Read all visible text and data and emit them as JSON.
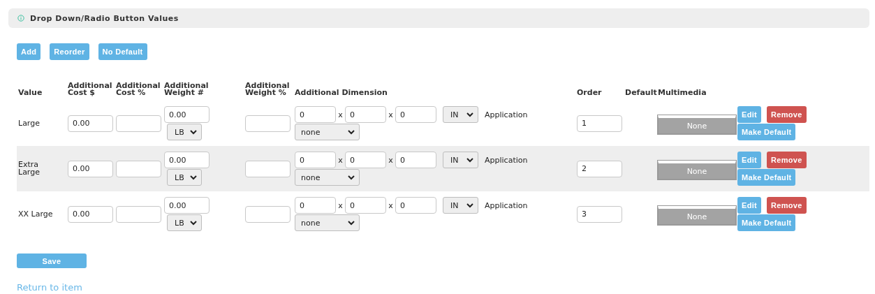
{
  "panel": {
    "title": "Drop Down/Radio Button Values"
  },
  "toolbar": [
    "Add",
    "Reorder",
    "No Default"
  ],
  "columns": [
    "Value",
    "Additional Cost $",
    "Additional Cost %",
    "Additional Weight #",
    "Additional Weight %",
    "Additional Dimension",
    "Order",
    "Default",
    "Multimedia"
  ],
  "rows": [
    {
      "value": "Large",
      "cost": "0.00",
      "weight": "0.00",
      "weight_unit": "LB",
      "dims": [
        "0",
        "0",
        "0"
      ],
      "separators": [
        "x",
        "x"
      ],
      "dim_unit": "IN",
      "application_label": "Application",
      "application": "none",
      "order": "1",
      "multimedia": "None",
      "actions": {
        "edit": "Edit",
        "remove": "Remove",
        "make_default": "Make Default"
      }
    },
    {
      "value": "Extra Large",
      "cost": "0.00",
      "weight": "0.00",
      "weight_unit": "LB",
      "dims": [
        "0",
        "0",
        "0"
      ],
      "separators": [
        "x",
        "x"
      ],
      "dim_unit": "IN",
      "application_label": "Application",
      "application": "none",
      "order": "2",
      "multimedia": "None",
      "actions": {
        "edit": "Edit",
        "remove": "Remove",
        "make_default": "Make Default"
      }
    },
    {
      "value": "XX Large",
      "cost": "0.00",
      "weight": "0.00",
      "weight_unit": "LB",
      "dims": [
        "0",
        "0",
        "0"
      ],
      "separators": [
        "x",
        "x"
      ],
      "dim_unit": "IN",
      "application_label": "Application",
      "application": "none",
      "order": "3",
      "multimedia": "None",
      "actions": {
        "edit": "Edit",
        "remove": "Remove",
        "make_default": "Make Default"
      }
    }
  ],
  "save": "Save",
  "link": "Return to item"
}
